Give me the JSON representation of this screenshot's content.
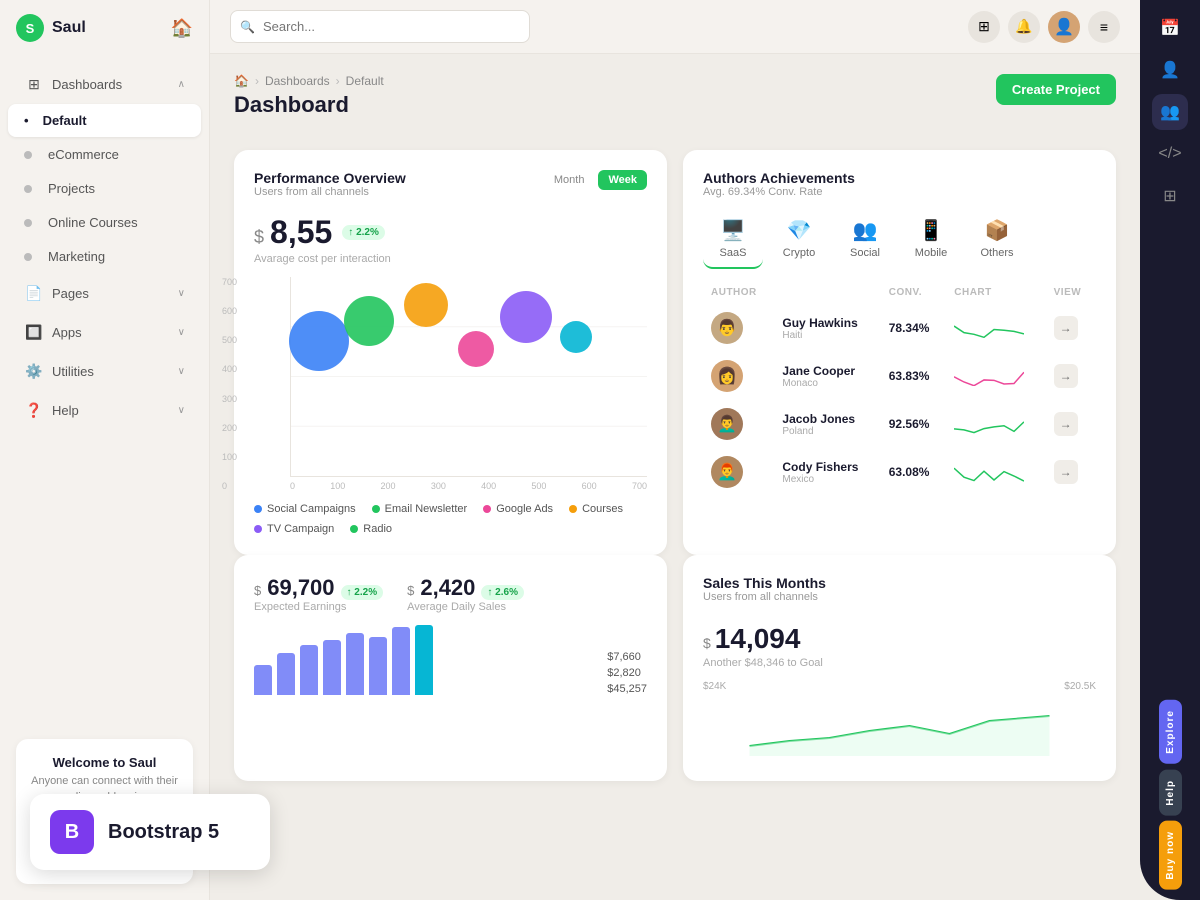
{
  "app": {
    "name": "Saul",
    "logo_letter": "S"
  },
  "sidebar": {
    "items": [
      {
        "id": "dashboards",
        "label": "Dashboards",
        "icon": "⊞",
        "has_chevron": true,
        "active": false
      },
      {
        "id": "default",
        "label": "Default",
        "icon": "",
        "active": true
      },
      {
        "id": "ecommerce",
        "label": "eCommerce",
        "icon": "",
        "active": false
      },
      {
        "id": "projects",
        "label": "Projects",
        "icon": "",
        "active": false
      },
      {
        "id": "online-courses",
        "label": "Online Courses",
        "icon": "",
        "active": false
      },
      {
        "id": "marketing",
        "label": "Marketing",
        "icon": "",
        "active": false
      },
      {
        "id": "pages",
        "label": "Pages",
        "icon": "📄",
        "has_chevron": true,
        "active": false
      },
      {
        "id": "apps",
        "label": "Apps",
        "icon": "🔲",
        "has_chevron": true,
        "active": false
      },
      {
        "id": "utilities",
        "label": "Utilities",
        "icon": "⚙️",
        "has_chevron": true,
        "active": false
      },
      {
        "id": "help",
        "label": "Help",
        "icon": "❓",
        "has_chevron": true,
        "active": false
      }
    ],
    "welcome": {
      "title": "Welcome to Saul",
      "subtitle": "Anyone can connect with their audience blogging"
    }
  },
  "topbar": {
    "search_placeholder": "Search...",
    "search_label": "Search _"
  },
  "breadcrumb": {
    "items": [
      "🏠",
      "Dashboards",
      "Default"
    ]
  },
  "page": {
    "title": "Dashboard",
    "create_btn": "Create Project"
  },
  "performance": {
    "title": "Performance Overview",
    "subtitle": "Users from all channels",
    "value": "8,55",
    "dollar": "$",
    "badge": "↑ 2.2%",
    "value_label": "Avarage cost per interaction",
    "toggle_month": "Month",
    "toggle_week": "Week",
    "y_labels": [
      "700",
      "600",
      "500",
      "400",
      "300",
      "200",
      "100",
      "0"
    ],
    "x_labels": [
      "0",
      "100",
      "200",
      "300",
      "400",
      "500",
      "600",
      "700"
    ],
    "bubbles": [
      {
        "x": 12,
        "y": 38,
        "size": 60,
        "color": "#3b82f6"
      },
      {
        "x": 24,
        "y": 30,
        "size": 50,
        "color": "#22c55e"
      },
      {
        "x": 36,
        "y": 22,
        "size": 44,
        "color": "#f59e0b"
      },
      {
        "x": 50,
        "y": 38,
        "size": 36,
        "color": "#ec4899"
      },
      {
        "x": 62,
        "y": 28,
        "size": 52,
        "color": "#8b5cf6"
      },
      {
        "x": 76,
        "y": 35,
        "size": 32,
        "color": "#06b6d4"
      }
    ],
    "legend": [
      {
        "label": "Social Campaigns",
        "color": "#3b82f6"
      },
      {
        "label": "Email Newsletter",
        "color": "#22c55e"
      },
      {
        "label": "Google Ads",
        "color": "#ec4899"
      },
      {
        "label": "Courses",
        "color": "#f59e0b"
      },
      {
        "label": "TV Campaign",
        "color": "#8b5cf6"
      },
      {
        "label": "Radio",
        "color": "#22c55e"
      }
    ]
  },
  "authors": {
    "title": "Authors Achievements",
    "subtitle": "Avg. 69.34% Conv. Rate",
    "tabs": [
      {
        "id": "saas",
        "label": "SaaS",
        "icon": "🖥️",
        "active": true
      },
      {
        "id": "crypto",
        "label": "Crypto",
        "icon": "💎",
        "active": false
      },
      {
        "id": "social",
        "label": "Social",
        "icon": "👥",
        "active": false
      },
      {
        "id": "mobile",
        "label": "Mobile",
        "icon": "📱",
        "active": false
      },
      {
        "id": "others",
        "label": "Others",
        "icon": "📦",
        "active": false
      }
    ],
    "columns": [
      "AUTHOR",
      "",
      "CONV.",
      "CHART",
      "VIEW"
    ],
    "rows": [
      {
        "name": "Guy Hawkins",
        "country": "Haiti",
        "conv": "78.34%",
        "chart_color": "#22c55e",
        "avatar_bg": "#c4a882"
      },
      {
        "name": "Jane Cooper",
        "country": "Monaco",
        "conv": "63.83%",
        "chart_color": "#ec4899",
        "avatar_bg": "#d4a373"
      },
      {
        "name": "Jacob Jones",
        "country": "Poland",
        "conv": "92.56%",
        "chart_color": "#22c55e",
        "avatar_bg": "#a0785a"
      },
      {
        "name": "Cody Fishers",
        "country": "Mexico",
        "conv": "63.08%",
        "chart_color": "#22c55e",
        "avatar_bg": "#b08860"
      }
    ]
  },
  "earnings": {
    "value1": "69,700",
    "badge1": "↑ 2.2%",
    "label1": "Expected Earnings",
    "value2": "2,420",
    "badge2": "↑ 2.6%",
    "label2": "Average Daily Sales",
    "amounts": [
      "$7,660",
      "$2,820",
      "$45,257"
    ],
    "bars": [
      30,
      45,
      55,
      60,
      70,
      65,
      75,
      80
    ]
  },
  "sales": {
    "title": "Sales This Months",
    "subtitle": "Users from all channels",
    "value": "14,094",
    "dollar": "$",
    "goal_text": "Another $48,346 to Goal",
    "level1": "$24K",
    "level2": "$20.5K"
  },
  "right_panel": {
    "labels": [
      "Explore",
      "Help",
      "Buy now"
    ]
  }
}
